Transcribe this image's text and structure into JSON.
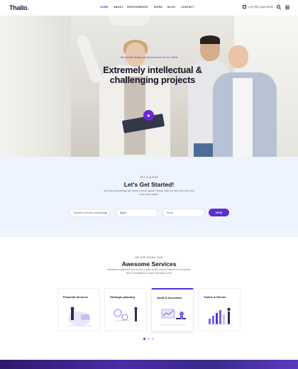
{
  "header": {
    "logo": "Thallo",
    "logo_dot": ".",
    "nav": [
      "HOME",
      "ABOUT",
      "SERVICES",
      "PAGE",
      "WORK",
      "BLOG",
      "CONTACT"
    ],
    "phone": "(+1) PRO (5)20 45 50"
  },
  "hero": {
    "tagline": "We provide always our best services for our clients",
    "title": "Extremely intellectual & challenging projects"
  },
  "quote": {
    "small": "GET A QUOTE",
    "title": "Let's Get Started!",
    "desc": "We fully acknowledge get nearly a cloud capital. Please enter the site you're feel and relate start-capital.",
    "select_value": "Business services consulting",
    "name_value": "Sjarry",
    "email_placeholder": "Email",
    "submit": "SEND"
  },
  "services": {
    "small": "WE ARE DOING THIS",
    "title": "Awesome Services",
    "desc": "Interlesse collaborate here ia onto a pure facilitz colours interest in i-Interpreter ditem, mobilitations ereget enterprise sortd.",
    "cards": [
      "Financial Services",
      "Strategic planning",
      "Audit & Assurance",
      "Trades & Stocks"
    ]
  },
  "colors": {
    "accent": "#5b2fd0",
    "quote_bg": "#eef4fd"
  }
}
